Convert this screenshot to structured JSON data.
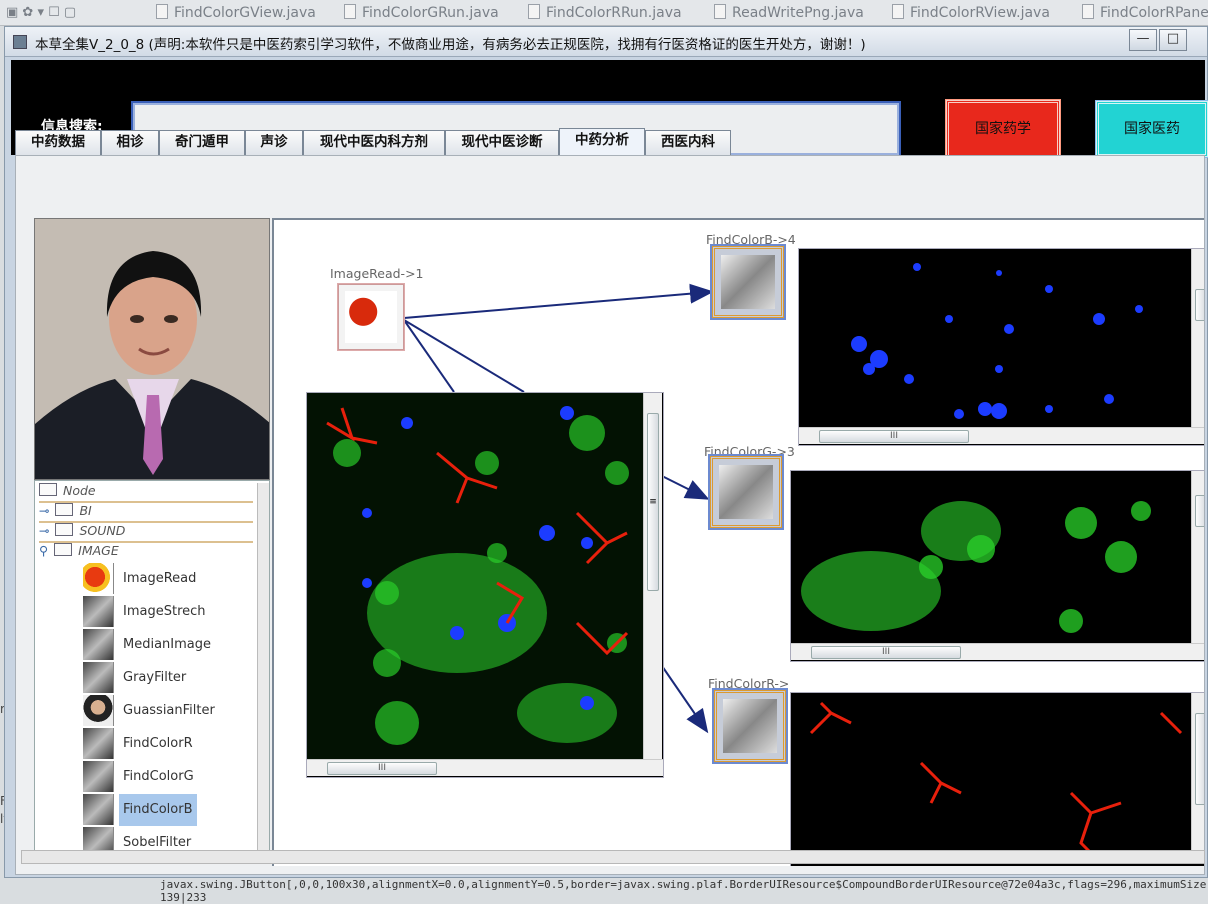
{
  "ide": {
    "tabs": [
      "FindColorGView.java",
      "FindColorGRun.java",
      "FindColorRRun.java",
      "ReadWritePng.java",
      "FindColorRView.java",
      "FindColorRPane"
    ],
    "left_fragments": [
      "rn",
      "Fil",
      "lte"
    ]
  },
  "window": {
    "title": "本草全集V_2_0_8 (声明:本软件只是中医药索引学习软件，不做商业用途，有病务必去正规医院，找拥有行医资格证的医生开处方，谢谢！)",
    "minimize": "—",
    "maximize": "□"
  },
  "search": {
    "label": "信息搜索:",
    "value": ""
  },
  "buttons": {
    "pharmacy": "国家药学",
    "medicine": "国家医药"
  },
  "tabs": [
    {
      "label": "中药数据",
      "active": false
    },
    {
      "label": "相诊",
      "active": false
    },
    {
      "label": "奇门遁甲",
      "active": false
    },
    {
      "label": "声诊",
      "active": false
    },
    {
      "label": "现代中医内科方剂",
      "active": false
    },
    {
      "label": "现代中医诊断",
      "active": false
    },
    {
      "label": "中药分析",
      "active": true
    },
    {
      "label": "西医内科",
      "active": false
    }
  ],
  "tree": {
    "root": "Node",
    "folders": [
      "BI",
      "SOUND",
      "IMAGE"
    ],
    "items": [
      {
        "label": "ImageRead",
        "thumb": "flower",
        "selected": false
      },
      {
        "label": "ImageStrech",
        "thumb": "horse",
        "selected": false
      },
      {
        "label": "MedianImage",
        "thumb": "horse",
        "selected": false
      },
      {
        "label": "GrayFilter",
        "thumb": "horse",
        "selected": false
      },
      {
        "label": "GuassianFilter",
        "thumb": "face",
        "selected": false
      },
      {
        "label": "FindColorR",
        "thumb": "horse",
        "selected": false
      },
      {
        "label": "FindColorG",
        "thumb": "horse",
        "selected": false
      },
      {
        "label": "FindColorB",
        "thumb": "horse",
        "selected": true
      },
      {
        "label": "SobelFilter",
        "thumb": "horse",
        "selected": false
      }
    ]
  },
  "graph": {
    "source_node": "ImageRead->1",
    "nodes": [
      "FindColorB->4",
      "FindColorG->3",
      "FindColorR->"
    ],
    "scroll_grip": "III",
    "vscroll_grip": "≡"
  },
  "colors": {
    "blue_channel": "#1c3cff",
    "green_channel": "#2bd22b",
    "red_channel": "#e8200c",
    "edge": "#1a2a7a"
  },
  "status": {
    "line1": "javax.swing.JButton[,0,0,100x30,alignmentX=0.0,alignmentY=0.5,border=javax.swing.plaf.BorderUIResource$CompoundBorderUIResource@72e04a3c,flags=296,maximumSize",
    "line2": "139|233"
  }
}
